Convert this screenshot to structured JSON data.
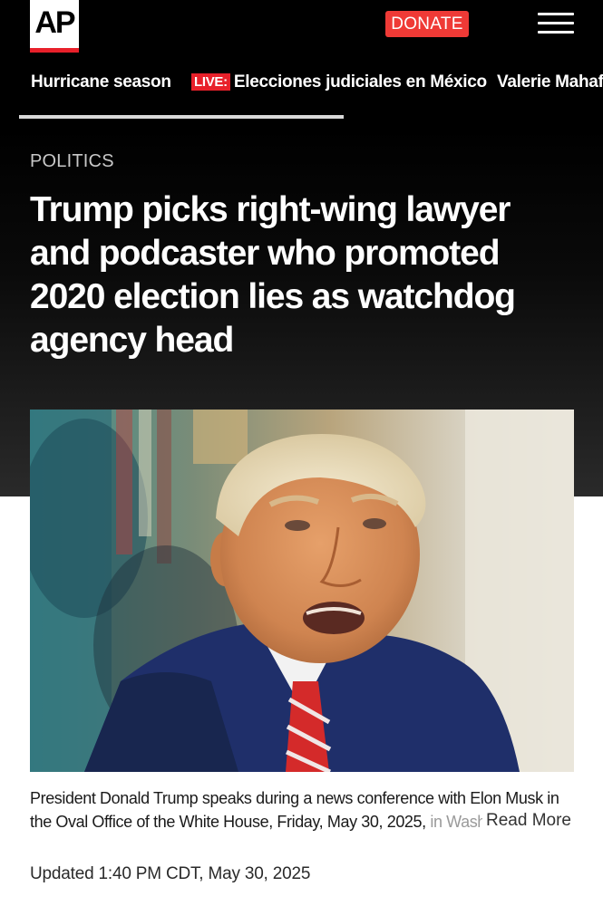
{
  "header": {
    "logo_text": "AP",
    "donate_label": "DONATE",
    "menu_icon": "hamburger-menu-icon"
  },
  "trending": {
    "items": [
      {
        "label": "Hurricane season",
        "live": false
      },
      {
        "label": "Elecciones judiciales en México",
        "live": true,
        "badge": "LIVE:"
      },
      {
        "label": "Valerie Mahaffey",
        "live": false
      }
    ]
  },
  "article": {
    "section": "POLITICS",
    "headline": "Trump picks right-wing lawyer and podcaster who promoted 2020 election lies as watchdog agency head",
    "caption_main": "President Donald Trump speaks during a news conference with Elon Musk in the Oval Office of the White House, Friday, May 30, 2025, ",
    "caption_faded": "in Washington.",
    "read_more": "Read More",
    "updated": "Updated 1:40 PM CDT, May 30, 2025"
  },
  "colors": {
    "brand_red": "#e8202a",
    "donate_bg": "#ef3a36",
    "hero_bg": "#000000"
  }
}
